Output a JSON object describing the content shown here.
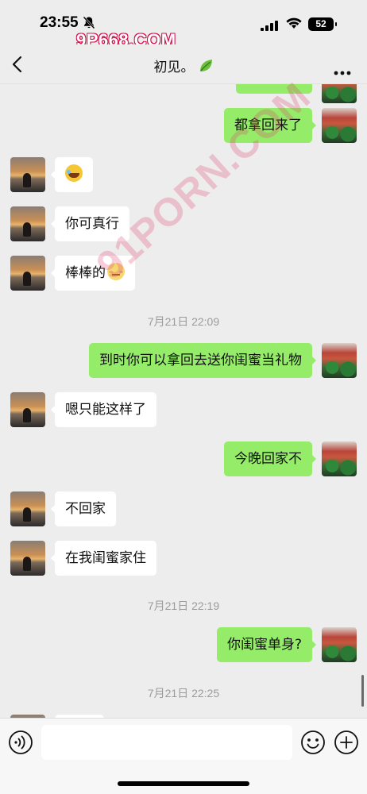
{
  "status_bar": {
    "time": "23:55",
    "battery": "52",
    "watermark": "9P668.COM"
  },
  "header": {
    "title": "初见。"
  },
  "messages": [
    {
      "side": "self",
      "text": "都拿回来了"
    },
    {
      "side": "peer",
      "emoji": "laugh"
    },
    {
      "side": "peer",
      "text": "你可真行"
    },
    {
      "side": "peer",
      "text": "棒棒的",
      "emoji": "blush"
    },
    {
      "timestamp": "7月21日 22:09"
    },
    {
      "side": "self",
      "text": "到时你可以拿回去送你闺蜜当礼物"
    },
    {
      "side": "peer",
      "text": "嗯只能这样了"
    },
    {
      "side": "self",
      "text": "今晚回家不"
    },
    {
      "side": "peer",
      "text": "不回家"
    },
    {
      "side": "peer",
      "text": "在我闺蜜家住"
    },
    {
      "timestamp": "7月21日 22:19"
    },
    {
      "side": "self",
      "text": "你闺蜜单身?"
    },
    {
      "timestamp": "7月21日 22:25"
    }
  ],
  "watermark_diagonal": "91PORN.COM",
  "input": {
    "value": ""
  },
  "icons": {
    "back": "chevron-left-icon",
    "more": "more-dots-icon",
    "voice": "voice-icon",
    "emoji": "emoji-icon",
    "plus": "plus-icon",
    "bell": "bell-slash-icon",
    "leaf": "leaf-icon"
  },
  "colors": {
    "self_bubble": "#95ec69",
    "peer_bubble": "#ffffff",
    "background": "#ededed"
  }
}
